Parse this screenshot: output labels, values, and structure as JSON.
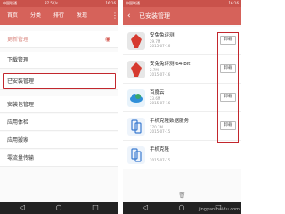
{
  "left": {
    "status": {
      "carrier": "中国联通",
      "speed": "87.5K/s",
      "time": "16:16"
    },
    "tabs": [
      {
        "label": "首页"
      },
      {
        "label": "分类"
      },
      {
        "label": "排行"
      },
      {
        "label": "发现"
      }
    ],
    "menu": [
      {
        "label": "更新管理"
      },
      {
        "label": "下载管理"
      },
      {
        "label": "已安装管理"
      },
      {
        "label": "安装包管理"
      },
      {
        "label": "应用体检"
      },
      {
        "label": "应用搬家"
      },
      {
        "label": "零流量传输"
      }
    ]
  },
  "right": {
    "status": {
      "carrier": "中国联通",
      "time": "16:16"
    },
    "title": "已安装管理",
    "uninstall_label": "卸载",
    "apps": [
      {
        "name": "安兔兔评测",
        "size": "29.7M",
        "date": "2015-07-16"
      },
      {
        "name": "安兔兔评测 64-bit",
        "size": "2.7M",
        "date": "2015-07-16"
      },
      {
        "name": "百度云",
        "size": "23.6M",
        "date": "2015-07-16"
      },
      {
        "name": "手机克隆数据服务",
        "size": "170.7M",
        "date": "2015-07-15"
      },
      {
        "name": "手机克隆",
        "size": "",
        "date": "2015-07-15"
      }
    ]
  },
  "watermark": "jingyan.baidu.com",
  "colors": {
    "header": "#d6625a",
    "status": "#c9524b",
    "highlight": "#c2272d"
  }
}
